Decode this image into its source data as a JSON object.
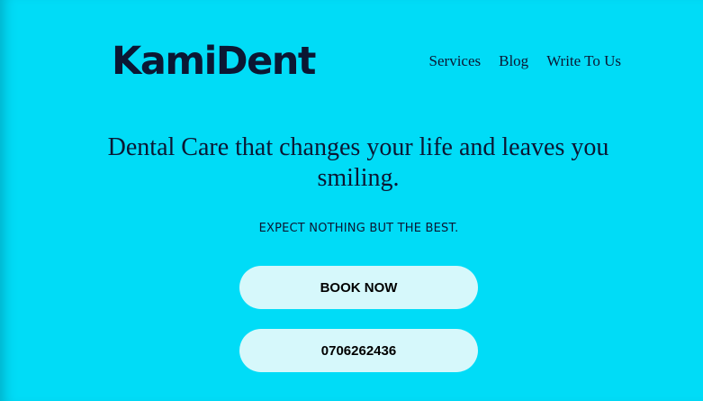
{
  "header": {
    "logo_text": "KamiDent",
    "nav": [
      {
        "label": "Services"
      },
      {
        "label": "Blog"
      },
      {
        "label": "Write To Us"
      }
    ]
  },
  "hero": {
    "headline": "Dental Care that changes your life and leaves you smiling.",
    "tagline": "EXPECT NOTHING BUT THE BEST.",
    "book_button_label": "BOOK NOW",
    "phone_button_label": "0706262436"
  },
  "colors": {
    "background": "#00dcf7",
    "text": "#0b1733",
    "button_bg": "#d6f8fb"
  }
}
